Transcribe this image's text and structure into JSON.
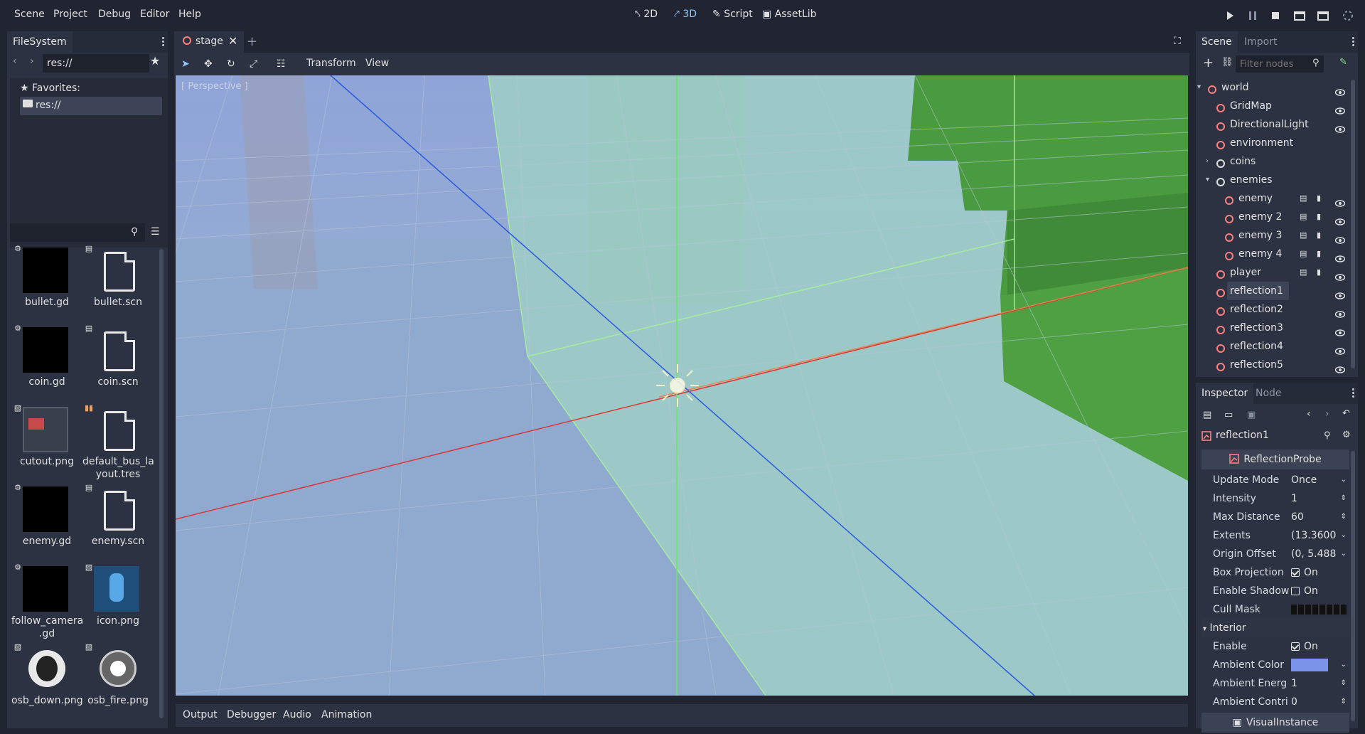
{
  "menu": [
    "Scene",
    "Project",
    "Debug",
    "Editor",
    "Help"
  ],
  "modes": {
    "two_d": "2D",
    "three_d": "3D",
    "script": "Script",
    "assetlib": "AssetLib"
  },
  "filesystem": {
    "tab": "FileSystem",
    "path": "res://",
    "favorites_label": "Favorites:",
    "root_label": "res://",
    "files": [
      {
        "name": "bullet.gd",
        "kind": "script-thumb"
      },
      {
        "name": "bullet.scn",
        "kind": "scene-doc"
      },
      {
        "name": "coin.gd",
        "kind": "script-thumb"
      },
      {
        "name": "coin.scn",
        "kind": "scene-doc"
      },
      {
        "name": "cutout.png",
        "kind": "image-thumb"
      },
      {
        "name": "default_bus_la yout.tres",
        "kind": "resource-doc"
      },
      {
        "name": "enemy.gd",
        "kind": "script-thumb"
      },
      {
        "name": "enemy.scn",
        "kind": "scene-doc"
      },
      {
        "name": "follow_camera .gd",
        "kind": "script-thumb"
      },
      {
        "name": "icon.png",
        "kind": "image-thumb"
      },
      {
        "name": "osb_down.png",
        "kind": "image-thumb"
      },
      {
        "name": "osb_fire.png",
        "kind": "image-thumb"
      }
    ]
  },
  "editor": {
    "scene_tab": "stage",
    "toolbar": {
      "transform": "Transform",
      "view": "View"
    },
    "viewport_label": "[ Perspective ]",
    "bottom_tabs": [
      "Output",
      "Debugger",
      "Audio",
      "Animation"
    ]
  },
  "scene_dock": {
    "tabs": {
      "scene": "Scene",
      "import": "Import"
    },
    "filter_placeholder": "Filter nodes",
    "nodes": [
      {
        "label": "world",
        "icon": "spatial-icon",
        "icon_color": "#fc7f7f"
      },
      {
        "label": "GridMap",
        "icon": "gridmap-icon",
        "icon_color": "#fc7f7f"
      },
      {
        "label": "DirectionalLight",
        "icon": "light-icon",
        "icon_color": "#fc7f7f"
      },
      {
        "label": "environment",
        "icon": "environment-icon",
        "icon_color": "#fc7f7f"
      },
      {
        "label": "coins",
        "icon": "spatial-icon",
        "icon_color": "#e0e0e0"
      },
      {
        "label": "enemies",
        "icon": "spatial-icon",
        "icon_color": "#e0e0e0"
      },
      {
        "label": "enemy",
        "icon": "instance-icon",
        "icon_color": "#fc7f7f"
      },
      {
        "label": "enemy 2",
        "icon": "instance-icon",
        "icon_color": "#fc7f7f"
      },
      {
        "label": "enemy 3",
        "icon": "instance-icon",
        "icon_color": "#fc7f7f"
      },
      {
        "label": "enemy 4",
        "icon": "instance-icon",
        "icon_color": "#fc7f7f"
      },
      {
        "label": "player",
        "icon": "body-icon",
        "icon_color": "#fc7f7f"
      },
      {
        "label": "reflection1",
        "icon": "reflection-probe-icon",
        "icon_color": "#fc7f7f"
      },
      {
        "label": "reflection2",
        "icon": "reflection-probe-icon",
        "icon_color": "#fc7f7f"
      },
      {
        "label": "reflection3",
        "icon": "reflection-probe-icon",
        "icon_color": "#fc7f7f"
      },
      {
        "label": "reflection4",
        "icon": "reflection-probe-icon",
        "icon_color": "#fc7f7f"
      },
      {
        "label": "reflection5",
        "icon": "reflection-probe-icon",
        "icon_color": "#fc7f7f"
      }
    ]
  },
  "inspector": {
    "tabs": {
      "inspector": "Inspector",
      "node": "Node"
    },
    "object_name": "reflection1",
    "class_header": "ReflectionProbe",
    "props": [
      {
        "name": "Update Mode",
        "value": "Once",
        "control": "dropdown"
      },
      {
        "name": "Intensity",
        "value": "1",
        "control": "spin"
      },
      {
        "name": "Max Distance",
        "value": "60",
        "control": "spin"
      },
      {
        "name": "Extents",
        "value": "(13.3600",
        "control": "dropdown"
      },
      {
        "name": "Origin Offset",
        "value": "(0, 5.488",
        "control": "dropdown"
      },
      {
        "name": "Box Projection",
        "value": "On",
        "control": "checkbox",
        "checked": true
      },
      {
        "name": "Enable Shadow",
        "value": "On",
        "control": "checkbox",
        "checked": false
      },
      {
        "name": "Cull Mask",
        "value": "",
        "control": "mask"
      }
    ],
    "interior_section": "Interior",
    "interior_props": [
      {
        "name": "Enable",
        "value": "On",
        "control": "checkbox",
        "checked": true
      },
      {
        "name": "Ambient Color",
        "value": "",
        "control": "color",
        "color": "#7b93e8"
      },
      {
        "name": "Ambient Energ",
        "value": "1",
        "control": "spin"
      },
      {
        "name": "Ambient Contri",
        "value": "0",
        "control": "spin"
      }
    ],
    "footer_section": "VisualInstance"
  },
  "colors": {
    "accent": "#8cc8ff",
    "node_red": "#fc7f7f",
    "probe_volume": "#9fd0c6"
  }
}
